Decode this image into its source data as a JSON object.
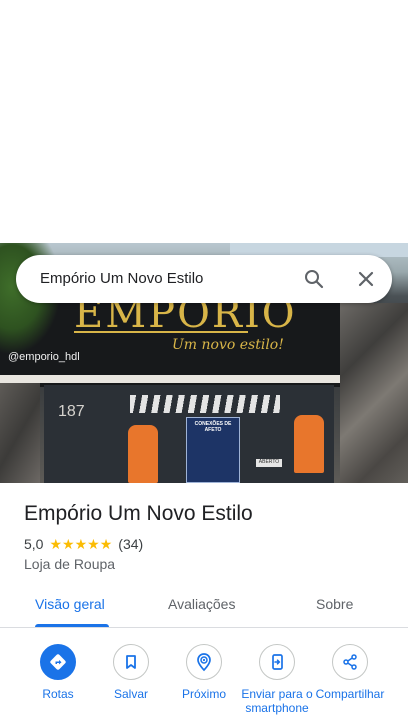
{
  "hero": {
    "sign_text": "EMPORIO",
    "sign_script": "Um novo estilo!",
    "instagram": "@emporio_hdl",
    "street_number": "187",
    "poster_text": "CONEXÕES DE AFETO",
    "door_sign": "ABERTO"
  },
  "search": {
    "query": "Empório Um Novo Estilo",
    "search_icon": "search-icon",
    "close_icon": "close-icon"
  },
  "place": {
    "title": "Empório Um Novo Estilo",
    "rating": "5,0",
    "stars": 5,
    "review_count": "(34)",
    "category": "Loja de Roupa"
  },
  "tabs": [
    {
      "label": "Visão geral",
      "active": true
    },
    {
      "label": "Avaliações",
      "active": false
    },
    {
      "label": "Sobre",
      "active": false
    }
  ],
  "actions": [
    {
      "label": "Rotas",
      "icon": "directions-icon"
    },
    {
      "label": "Salvar",
      "icon": "bookmark-icon"
    },
    {
      "label": "Próximo",
      "icon": "nearby-icon"
    },
    {
      "label": "Enviar para o smartphone",
      "icon": "send-to-phone-icon"
    },
    {
      "label": "Compartilhar",
      "icon": "share-icon"
    }
  ],
  "colors": {
    "accent": "#1a73e8",
    "star": "#fbbc04",
    "text": "#202124"
  }
}
